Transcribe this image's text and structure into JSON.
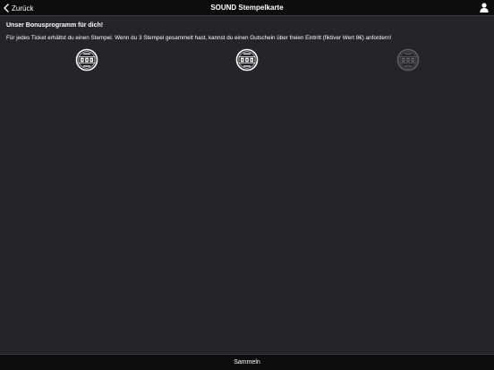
{
  "navbar": {
    "back_label": "Zurück",
    "title": "SOUND Stempelkarte",
    "back_icon": "chevron-left-icon",
    "user_icon": "user-icon"
  },
  "main": {
    "heading": "Unser Bonusprogramm für dich!",
    "description": "Für jedes Ticket erhältst du einen Stempel. Wenn du 3 Stempel gesammelt hast, kannst du einen Gutschein über freien Eintritt (fiktiver Wert 8€) anfordern!",
    "stamps": [
      {
        "icon": "sound-stamp-icon",
        "collected": true
      },
      {
        "icon": "sound-stamp-icon",
        "collected": true
      },
      {
        "icon": "sound-stamp-icon",
        "collected": false
      }
    ]
  },
  "bottom_bar": {
    "collect_label": "Sammeln"
  },
  "colors": {
    "background": "#252528",
    "bars": "#0d0d0d",
    "text": "#ffffff"
  }
}
